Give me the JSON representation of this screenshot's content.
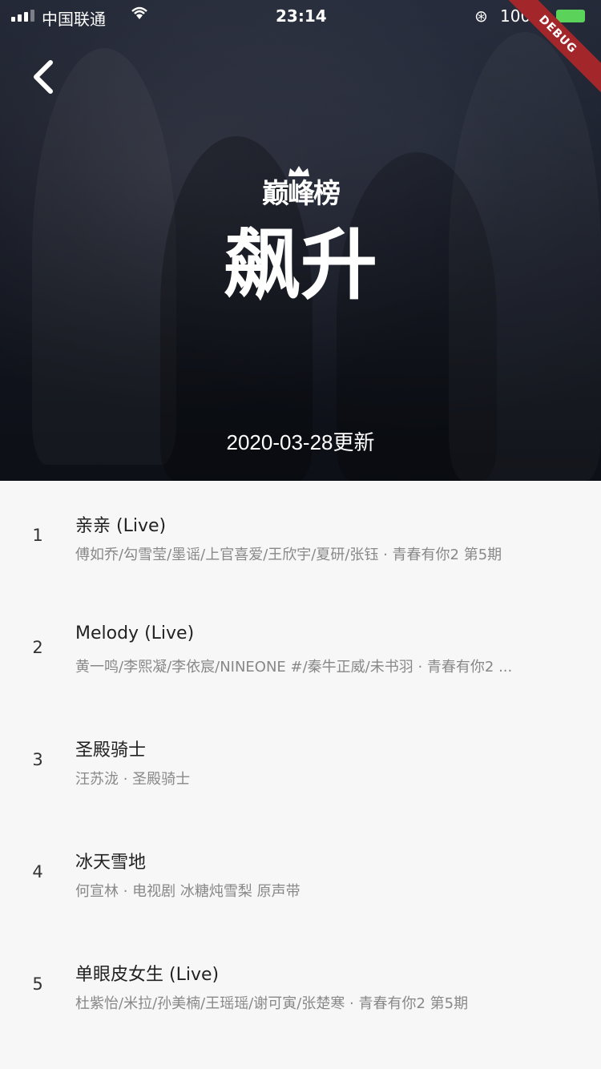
{
  "status_bar": {
    "carrier": "中国联通",
    "time": "23:14",
    "battery": "100%"
  },
  "debug_label": "DEBUG",
  "header": {
    "logo_small": "巅峰榜",
    "logo_big": "飙升",
    "update_text": "2020-03-28更新"
  },
  "songs": [
    {
      "rank": "1",
      "title": "亲亲 (Live)",
      "meta": "傅如乔/勾雪莹/墨谣/上官喜爱/王欣宇/夏研/张钰 · 青春有你2 第5期"
    },
    {
      "rank": "2",
      "title": "Melody (Live)",
      "meta": "黄一鸣/李熙凝/李依宸/NINEONE #/秦牛正威/未书羽 · 青春有你2 ..."
    },
    {
      "rank": "3",
      "title": "圣殿骑士",
      "meta": "汪苏泷 · 圣殿骑士"
    },
    {
      "rank": "4",
      "title": "冰天雪地",
      "meta": "何宣林 · 电视剧 冰糖炖雪梨 原声带"
    },
    {
      "rank": "5",
      "title": "单眼皮女生 (Live)",
      "meta": "杜紫怡/米拉/孙美楠/王瑶瑶/谢可寅/张楚寒 · 青春有你2 第5期"
    }
  ]
}
